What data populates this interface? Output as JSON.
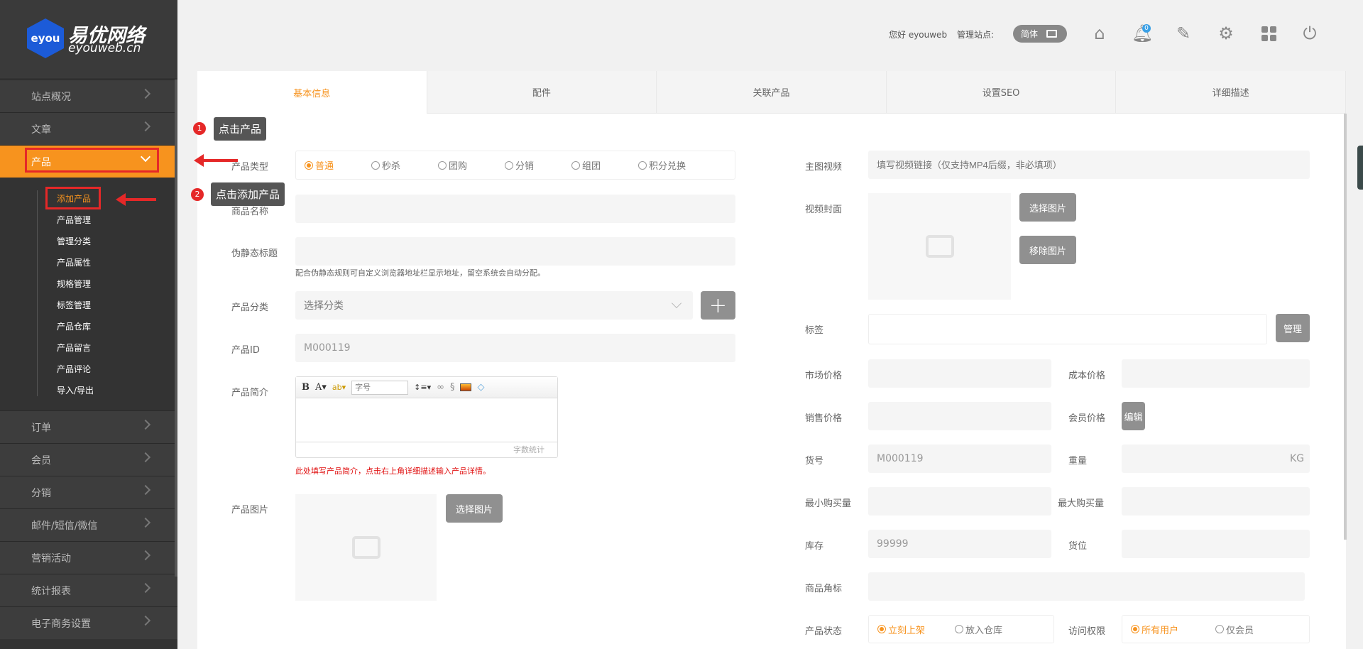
{
  "brand": {
    "logo_mark": "eyou",
    "name_cn": "易优网络",
    "domain": "eyouweb.cn"
  },
  "header": {
    "greeting": "您好 eyouweb",
    "site_label": "管理站点:",
    "lang_pill": "简体",
    "notification_count": "0",
    "icons": [
      "home-icon",
      "bell-icon",
      "edit-icon",
      "gear-icon",
      "grid-icon",
      "power-icon"
    ]
  },
  "sidebar": {
    "items_top": [
      {
        "label": "站点概况"
      },
      {
        "label": "文章"
      },
      {
        "label": "产品",
        "active": true
      }
    ],
    "sub_items": [
      {
        "label": "添加产品",
        "active": true
      },
      {
        "label": "产品管理"
      },
      {
        "label": "管理分类"
      },
      {
        "label": "产品属性"
      },
      {
        "label": "规格管理"
      },
      {
        "label": "标签管理"
      },
      {
        "label": "产品仓库"
      },
      {
        "label": "产品留言"
      },
      {
        "label": "产品评论"
      },
      {
        "label": "导入/导出"
      }
    ],
    "items_bottom": [
      {
        "label": "订单"
      },
      {
        "label": "会员"
      },
      {
        "label": "分销"
      },
      {
        "label": "邮件/短信/微信"
      },
      {
        "label": "营销活动"
      },
      {
        "label": "统计报表"
      },
      {
        "label": "电子商务设置"
      }
    ]
  },
  "tabs": [
    {
      "label": "基本信息",
      "active": true
    },
    {
      "label": "配件"
    },
    {
      "label": "关联产品"
    },
    {
      "label": "设置SEO"
    },
    {
      "label": "详细描述"
    }
  ],
  "annotations": {
    "step1_num": "1",
    "step1_text": "点击产品",
    "step2_num": "2",
    "step2_text": "点击添加产品"
  },
  "form_left": {
    "product_type": {
      "label": "产品类型",
      "options": [
        "普通",
        "秒杀",
        "团购",
        "分销",
        "组团",
        "积分兑换"
      ],
      "selected": "普通"
    },
    "name": {
      "label": "商品名称",
      "value": ""
    },
    "static_title": {
      "label": "伪静态标题",
      "value": "",
      "hint": "配合伪静态规则可自定义浏览器地址栏显示地址，留空系统会自动分配。"
    },
    "category": {
      "label": "产品分类",
      "value": "选择分类",
      "add_label": "+"
    },
    "product_id": {
      "label": "产品ID",
      "value": "M000119"
    },
    "intro": {
      "label": "产品简介",
      "font_size_placeholder": "字号",
      "word_count": "字数统计",
      "hint": "此处填写产品简介，点击右上角详细描述输入产品详情。"
    },
    "image": {
      "label": "产品图片",
      "button": "选择图片"
    }
  },
  "form_right": {
    "video": {
      "label": "主图视频",
      "placeholder": "填写视频链接（仅支持MP4后缀，非必填项）"
    },
    "cover": {
      "label": "视频封面",
      "select_button": "选择图片",
      "remove_button": "移除图片"
    },
    "tags": {
      "label": "标签",
      "manage_button": "管理"
    },
    "market_price": {
      "label": "市场价格",
      "value": ""
    },
    "cost_price": {
      "label": "成本价格",
      "value": ""
    },
    "sale_price": {
      "label": "销售价格",
      "value": ""
    },
    "member_price": {
      "label": "会员价格",
      "button": "编辑"
    },
    "sku": {
      "label": "货号",
      "value": "M000119"
    },
    "weight": {
      "label": "重量",
      "unit": "KG"
    },
    "min_buy": {
      "label": "最小购买量",
      "value": ""
    },
    "max_buy": {
      "label": "最大购买量",
      "value": ""
    },
    "stock": {
      "label": "库存",
      "value": "99999"
    },
    "location": {
      "label": "货位",
      "value": ""
    },
    "corner": {
      "label": "商品角标",
      "value": ""
    },
    "status": {
      "label": "产品状态",
      "options": [
        "立刻上架",
        "放入仓库"
      ],
      "selected": "立刻上架"
    },
    "access": {
      "label": "访问权限",
      "options": [
        "所有用户",
        "仅会员"
      ],
      "selected": "所有用户"
    }
  },
  "colors": {
    "accent": "#f7931e",
    "sidebar_bg": "#333333",
    "annotation_red": "#e52828"
  }
}
